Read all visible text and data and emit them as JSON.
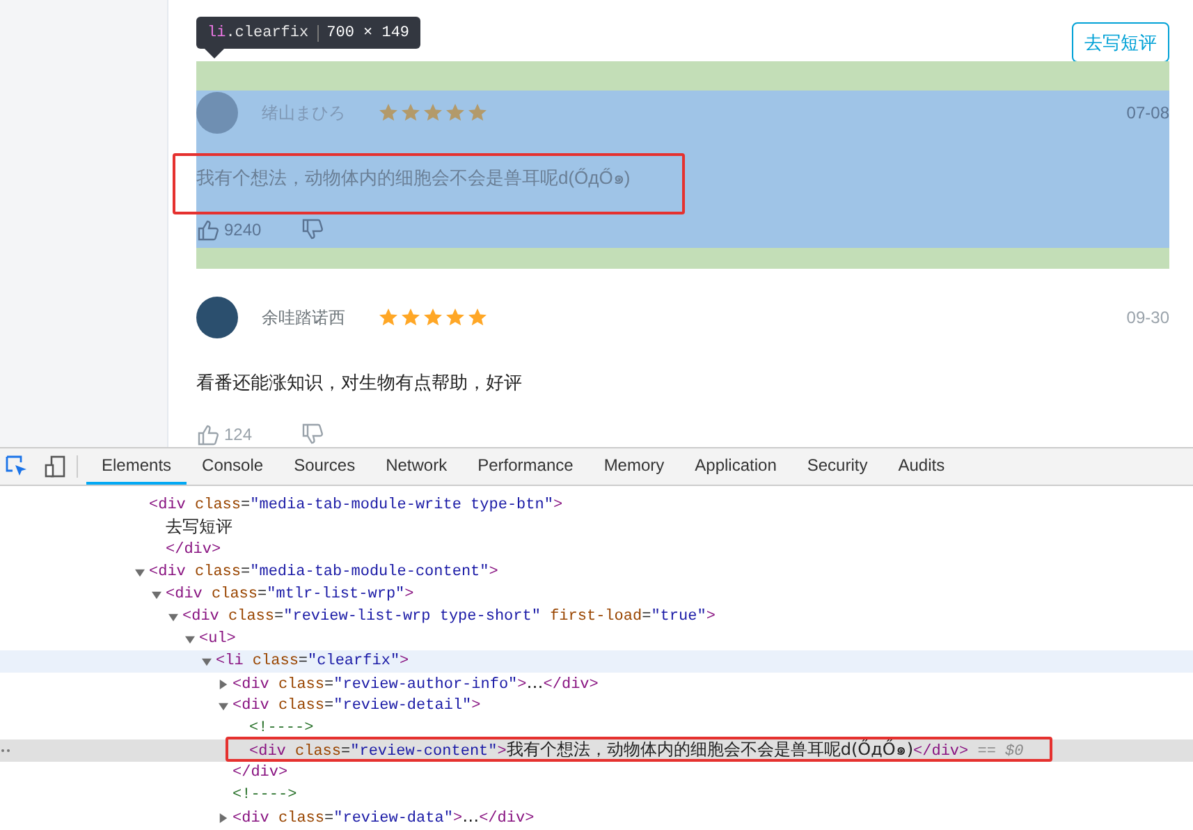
{
  "tooltip": {
    "tag": "li",
    "cls": ".clearfix",
    "size": "700 × 149"
  },
  "write_button": "去写短评",
  "reviews": [
    {
      "author": "绪山まひろ",
      "stars": 5,
      "date": "07-08",
      "content": "我有个想法，动物体内的细胞会不会是兽耳呢d(ŐдŐ๑)",
      "likes": "9240",
      "highlighted": true
    },
    {
      "author": "余哇踏诺西",
      "stars": 5,
      "date": "09-30",
      "content": "看番还能涨知识，对生物有点帮助，好评",
      "likes": "124",
      "highlighted": false
    }
  ],
  "devtools": {
    "tabs": [
      {
        "label": "Elements",
        "selected": true
      },
      {
        "label": "Console",
        "selected": false
      },
      {
        "label": "Sources",
        "selected": false
      },
      {
        "label": "Network",
        "selected": false
      },
      {
        "label": "Performance",
        "selected": false
      },
      {
        "label": "Memory",
        "selected": false
      },
      {
        "label": "Application",
        "selected": false
      },
      {
        "label": "Security",
        "selected": false
      },
      {
        "label": "Audits",
        "selected": false
      }
    ],
    "nodes": [
      {
        "selected": false,
        "hovered": false,
        "parts": [
          {
            "kind": "tag",
            "text": "<div"
          },
          {
            "kind": "attr",
            "text": " class"
          },
          {
            "kind": "punct",
            "text": "="
          },
          {
            "kind": "value",
            "text": "\"media-tab-module-write type-btn\""
          },
          {
            "kind": "tag",
            "text": ">"
          }
        ],
        "children": [
          {
            "selected": false,
            "hovered": false,
            "parts": [
              {
                "kind": "plain",
                "text": "去写短评"
              }
            ]
          },
          {
            "selected": false,
            "hovered": false,
            "parts": [
              {
                "kind": "tag",
                "text": "</div>"
              }
            ]
          }
        ]
      },
      {
        "expanded": true,
        "selected": false,
        "hovered": false,
        "parts": [
          {
            "kind": "tag",
            "text": "<div"
          },
          {
            "kind": "attr",
            "text": " class"
          },
          {
            "kind": "punct",
            "text": "="
          },
          {
            "kind": "value",
            "text": "\"media-tab-module-content\""
          },
          {
            "kind": "tag",
            "text": ">"
          }
        ],
        "children": [
          {
            "expanded": true,
            "selected": false,
            "hovered": false,
            "parts": [
              {
                "kind": "tag",
                "text": "<div"
              },
              {
                "kind": "attr",
                "text": " class"
              },
              {
                "kind": "punct",
                "text": "="
              },
              {
                "kind": "value",
                "text": "\"mtlr-list-wrp\""
              },
              {
                "kind": "tag",
                "text": ">"
              }
            ],
            "children": [
              {
                "expanded": true,
                "selected": false,
                "hovered": false,
                "parts": [
                  {
                    "kind": "tag",
                    "text": "<div"
                  },
                  {
                    "kind": "attr",
                    "text": " class"
                  },
                  {
                    "kind": "punct",
                    "text": "="
                  },
                  {
                    "kind": "value",
                    "text": "\"review-list-wrp type-short\""
                  },
                  {
                    "kind": "attr",
                    "text": " first-load"
                  },
                  {
                    "kind": "punct",
                    "text": "="
                  },
                  {
                    "kind": "value",
                    "text": "\"true\""
                  },
                  {
                    "kind": "tag",
                    "text": ">"
                  }
                ],
                "children": [
                  {
                    "expanded": true,
                    "selected": false,
                    "hovered": false,
                    "parts": [
                      {
                        "kind": "tag",
                        "text": "<ul>"
                      }
                    ],
                    "children": [
                      {
                        "expanded": true,
                        "selected": false,
                        "hovered": true,
                        "parts": [
                          {
                            "kind": "tag",
                            "text": "<li"
                          },
                          {
                            "kind": "attr",
                            "text": " class"
                          },
                          {
                            "kind": "punct",
                            "text": "="
                          },
                          {
                            "kind": "value",
                            "text": "\"clearfix\""
                          },
                          {
                            "kind": "tag",
                            "text": ">"
                          }
                        ],
                        "children": [
                          {
                            "expanded": false,
                            "selected": false,
                            "hovered": false,
                            "parts": [
                              {
                                "kind": "tag",
                                "text": "<div"
                              },
                              {
                                "kind": "attr",
                                "text": " class"
                              },
                              {
                                "kind": "punct",
                                "text": "="
                              },
                              {
                                "kind": "value",
                                "text": "\"review-author-info\""
                              },
                              {
                                "kind": "tag",
                                "text": ">"
                              },
                              {
                                "kind": "plain",
                                "text": "…"
                              },
                              {
                                "kind": "tag",
                                "text": "</div>"
                              }
                            ]
                          },
                          {
                            "expanded": true,
                            "selected": false,
                            "hovered": false,
                            "parts": [
                              {
                                "kind": "tag",
                                "text": "<div"
                              },
                              {
                                "kind": "attr",
                                "text": " class"
                              },
                              {
                                "kind": "punct",
                                "text": "="
                              },
                              {
                                "kind": "value",
                                "text": "\"review-detail\""
                              },
                              {
                                "kind": "tag",
                                "text": ">"
                              }
                            ],
                            "children": [
                              {
                                "selected": false,
                                "hovered": false,
                                "parts": [
                                  {
                                    "kind": "comment",
                                    "text": "<!---->"
                                  }
                                ]
                              },
                              {
                                "selected": true,
                                "hovered": false,
                                "parts": [
                                  {
                                    "kind": "tag",
                                    "text": "<div"
                                  },
                                  {
                                    "kind": "attr",
                                    "text": " class"
                                  },
                                  {
                                    "kind": "punct",
                                    "text": "="
                                  },
                                  {
                                    "kind": "value",
                                    "text": "\"review-content\""
                                  },
                                  {
                                    "kind": "tag",
                                    "text": ">"
                                  },
                                  {
                                    "kind": "plain",
                                    "text": "我有个想法，动物体内的细胞会不会是兽耳呢d(ŐдŐ๑)"
                                  },
                                  {
                                    "kind": "tag",
                                    "text": "</div>"
                                  },
                                  {
                                    "kind": "marker",
                                    "text": " == $0"
                                  }
                                ]
                              }
                            ]
                          },
                          {
                            "selected": false,
                            "hovered": false,
                            "parts": [
                              {
                                "kind": "tag",
                                "text": "</div>"
                              }
                            ]
                          },
                          {
                            "selected": false,
                            "hovered": false,
                            "parts": [
                              {
                                "kind": "comment",
                                "text": "<!---->"
                              }
                            ]
                          },
                          {
                            "expanded": false,
                            "selected": false,
                            "hovered": false,
                            "parts": [
                              {
                                "kind": "tag",
                                "text": "<div"
                              },
                              {
                                "kind": "attr",
                                "text": " class"
                              },
                              {
                                "kind": "punct",
                                "text": "="
                              },
                              {
                                "kind": "value",
                                "text": "\"review-data\""
                              },
                              {
                                "kind": "tag",
                                "text": ">"
                              },
                              {
                                "kind": "plain",
                                "text": "…"
                              },
                              {
                                "kind": "tag",
                                "text": "</div>"
                              }
                            ]
                          }
                        ]
                      }
                    ]
                  }
                ]
              }
            ]
          }
        ]
      }
    ]
  }
}
